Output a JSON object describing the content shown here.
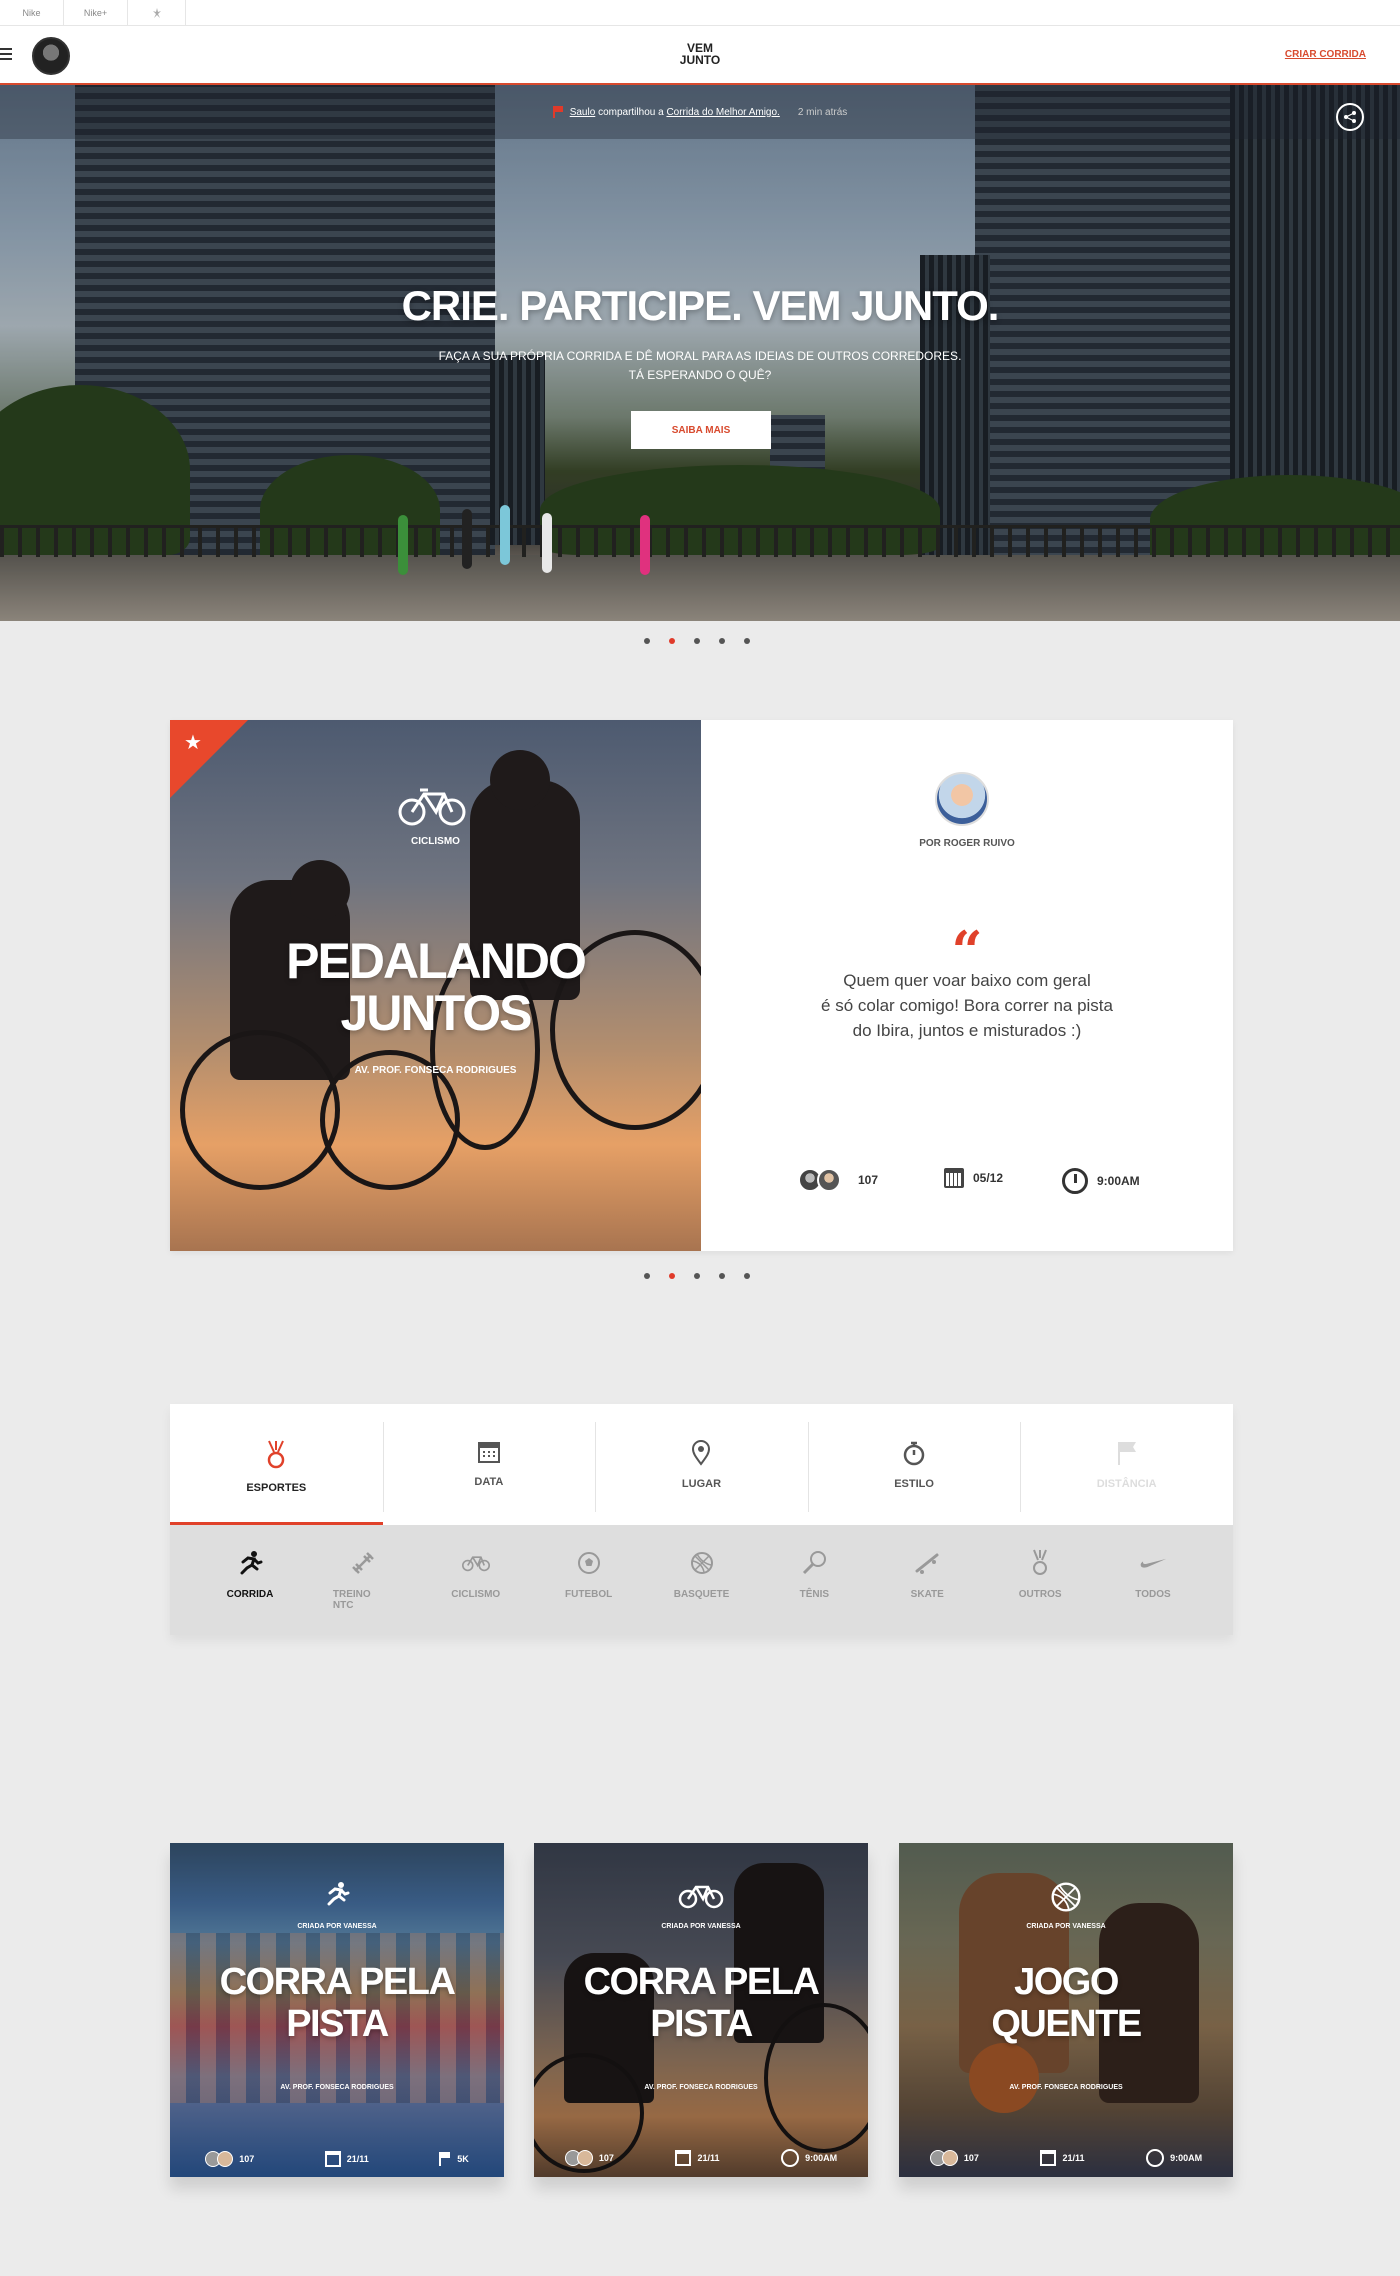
{
  "brandbar": {
    "tabs": [
      "Nike",
      "Nike+",
      ""
    ]
  },
  "header": {
    "logo_line1": "VEM",
    "logo_line2": "JUNTO",
    "cta": "CRIAR CORRIDA"
  },
  "hero": {
    "notification": {
      "who": "Saulo",
      "text": "compartilhou a",
      "link": "Corrida do Melhor Amigo.",
      "time": "2 min atrás"
    },
    "title": "CRIE. PARTICIPE. VEM JUNTO.",
    "subtitle_line1": "FAÇA A SUA PRÓPRIA CORRIDA E DÊ MORAL PARA AS IDEIAS DE OUTROS CORREDORES.",
    "subtitle_line2": "TÁ ESPERANDO O QUÊ?",
    "button": "SAIBA MAIS",
    "active_slide": 2,
    "slides": 5
  },
  "feature": {
    "type": "CICLISMO",
    "title_line1": "PEDALANDO",
    "title_line2": "JUNTOS",
    "location": "AV. PROF. FONSECA RODRIGUES",
    "author": "POR ROGER RUIVO",
    "quote_mark": "“",
    "quote_line1": "Quem quer voar baixo com geral",
    "quote_line2": "é só colar comigo! Bora correr na pista",
    "quote_line3": "do Ibira, juntos e misturados :)",
    "participants": "107",
    "date": "05/12",
    "time": "9:00AM",
    "active_slide": 2,
    "slides": 5
  },
  "filter": {
    "tabs": [
      {
        "label": "ESPORTES",
        "icon": "medal-icon",
        "state": "active"
      },
      {
        "label": "DATA",
        "icon": "calendar-icon",
        "state": "normal"
      },
      {
        "label": "LUGAR",
        "icon": "pin-icon",
        "state": "normal"
      },
      {
        "label": "ESTILO",
        "icon": "stopwatch-icon",
        "state": "normal"
      },
      {
        "label": "DISTÂNCIA",
        "icon": "flag-icon",
        "state": "disabled"
      }
    ],
    "sports": [
      {
        "label": "CORRIDA",
        "icon": "runner-icon",
        "active": true
      },
      {
        "label": "TREINO NTC",
        "icon": "dumbbell-icon"
      },
      {
        "label": "CICLISMO",
        "icon": "bike-icon"
      },
      {
        "label": "FUTEBOL",
        "icon": "soccer-icon"
      },
      {
        "label": "BASQUETE",
        "icon": "basketball-icon"
      },
      {
        "label": "TÊNIS",
        "icon": "tennis-icon"
      },
      {
        "label": "SKATE",
        "icon": "skate-icon"
      },
      {
        "label": "OUTROS",
        "icon": "medal-icon"
      },
      {
        "label": "TODOS",
        "icon": "swoosh-icon"
      }
    ]
  },
  "cards": [
    {
      "creator": "CRIADA POR VANESSA",
      "title_line1": "CORRA PELA",
      "title_line2": "PISTA",
      "location": "AV. PROF. FONSECA RODRIGUES",
      "participants": "107",
      "date": "21/11",
      "extra": "5K",
      "icon": "runner-icon"
    },
    {
      "creator": "CRIADA POR VANESSA",
      "title_line1": "CORRA PELA",
      "title_line2": "PISTA",
      "location": "AV. PROF. FONSECA RODRIGUES",
      "participants": "107",
      "date": "21/11",
      "extra": "9:00AM",
      "icon": "bike-icon"
    },
    {
      "creator": "CRIADA POR VANESSA",
      "title_line1": "JOGO",
      "title_line2": "QUENTE",
      "location": "AV. PROF. FONSECA RODRIGUES",
      "participants": "107",
      "date": "21/11",
      "extra": "9:00AM",
      "icon": "basketball-icon"
    }
  ],
  "colors": {
    "accent": "#e0412a",
    "background": "#ebebeb"
  }
}
